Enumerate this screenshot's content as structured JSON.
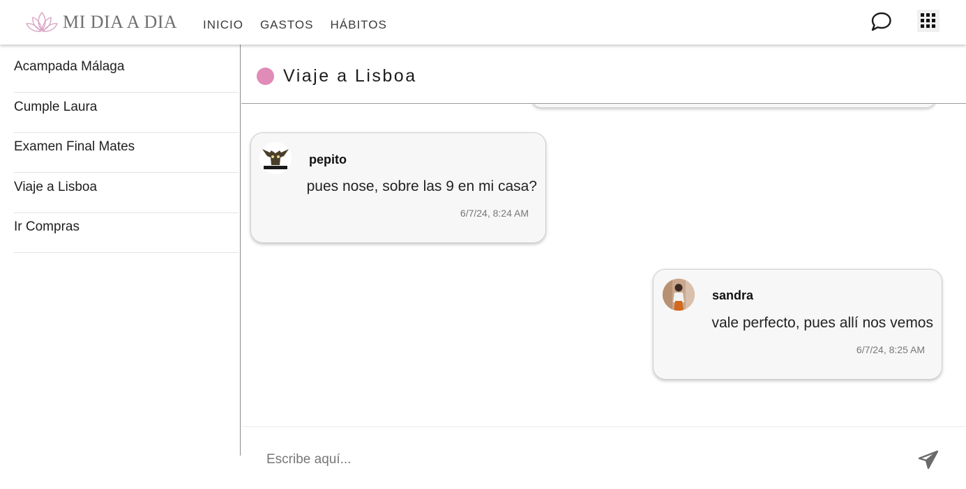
{
  "app": {
    "brand": "MI DIA A DIA",
    "accent": "#e08bb8"
  },
  "nav": {
    "items": [
      {
        "label": "INICIO"
      },
      {
        "label": "GASTOS"
      },
      {
        "label": "HÁBITOS"
      }
    ]
  },
  "header_actions": [
    {
      "icon": "chat-bubble-icon"
    },
    {
      "icon": "apps-grid-icon"
    }
  ],
  "sidebar": {
    "items": [
      {
        "label": "Acampada Málaga"
      },
      {
        "label": "Cumple Laura"
      },
      {
        "label": "Examen Final Mates"
      },
      {
        "label": "Viaje a Lisboa"
      },
      {
        "label": "Ir Compras"
      }
    ]
  },
  "chat": {
    "title": "Viaje a Lisboa",
    "status_color": "#e08bb8",
    "messages": [
      {
        "user": "pepito",
        "text": "pues nose, sobre las 9 en mi casa?",
        "time": "6/7/24, 8:24 AM",
        "avatar_icon": "gremlin-avatar-icon"
      },
      {
        "user": "sandra",
        "text": "vale perfecto, pues allí nos vemos",
        "time": "6/7/24, 8:25 AM",
        "avatar_icon": "user-photo-avatar-icon"
      }
    ]
  },
  "composer": {
    "placeholder": "Escribe aquí...",
    "value": "",
    "send_icon": "send-icon"
  }
}
